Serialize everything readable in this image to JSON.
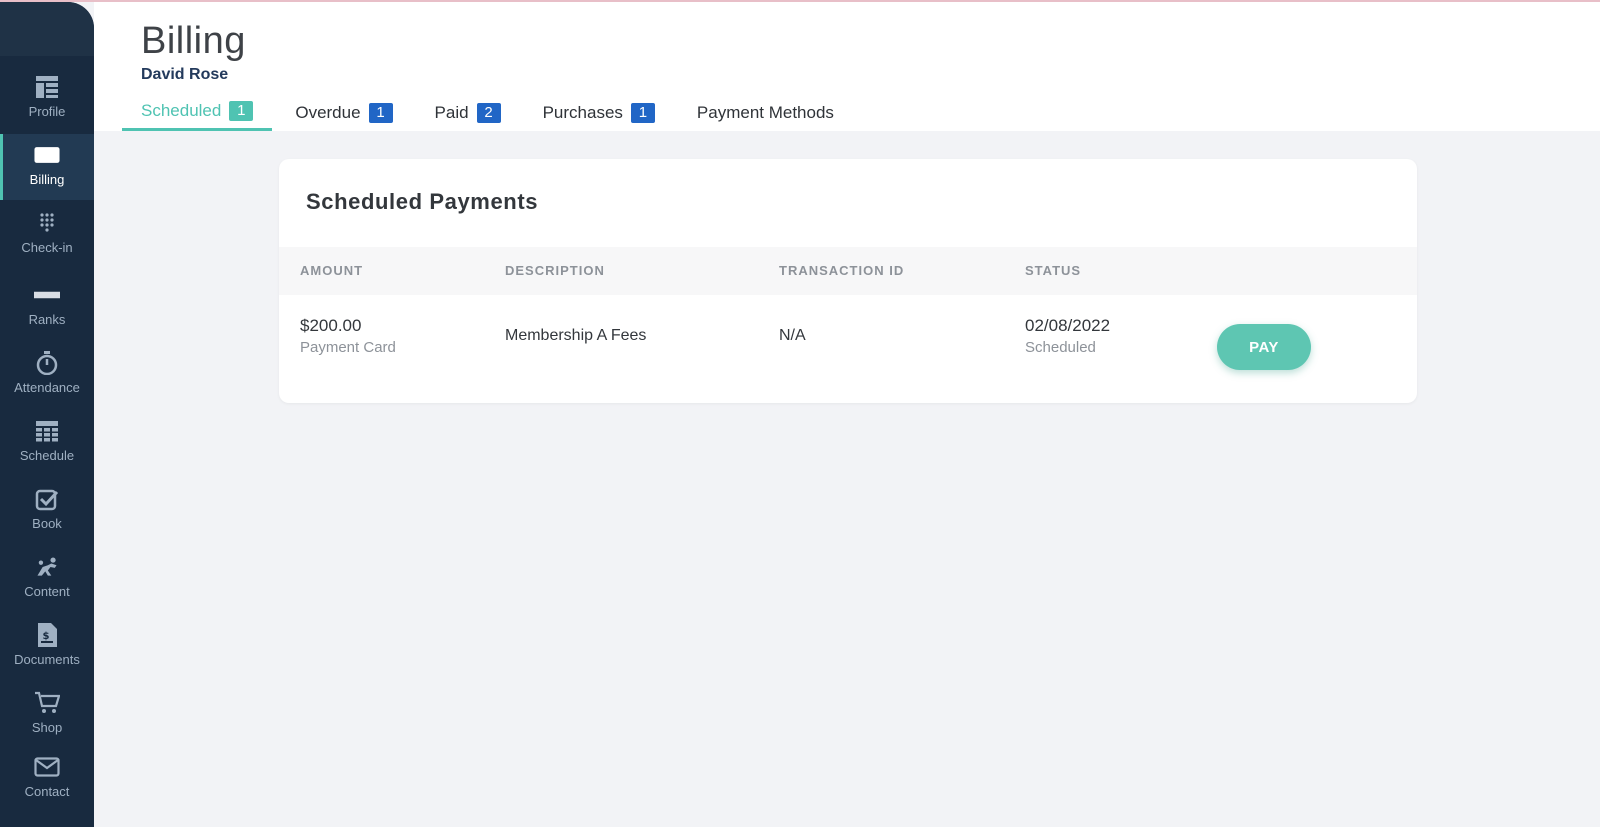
{
  "page": {
    "title": "Billing",
    "user_name": "David Rose"
  },
  "sidebar": {
    "items": [
      {
        "label": "Profile",
        "icon": "profile-icon",
        "active": false
      },
      {
        "label": "Billing",
        "icon": "billing-icon",
        "active": true
      },
      {
        "label": "Check-in",
        "icon": "keypad-icon",
        "active": false
      },
      {
        "label": "Ranks",
        "icon": "rank-belt-icon",
        "active": false
      },
      {
        "label": "Attendance",
        "icon": "stopwatch-icon",
        "active": false
      },
      {
        "label": "Schedule",
        "icon": "calendar-grid-icon",
        "active": false
      },
      {
        "label": "Book",
        "icon": "checkbox-icon",
        "active": false
      },
      {
        "label": "Content",
        "icon": "martial-arts-icon",
        "active": false
      },
      {
        "label": "Documents",
        "icon": "document-icon",
        "active": false
      },
      {
        "label": "Shop",
        "icon": "cart-icon",
        "active": false
      },
      {
        "label": "Contact",
        "icon": "envelope-icon",
        "active": false
      }
    ]
  },
  "tabs": [
    {
      "label": "Scheduled",
      "count": "1",
      "active": true
    },
    {
      "label": "Overdue",
      "count": "1",
      "active": false
    },
    {
      "label": "Paid",
      "count": "2",
      "active": false
    },
    {
      "label": "Purchases",
      "count": "1",
      "active": false
    },
    {
      "label": "Payment Methods",
      "count": null,
      "active": false
    }
  ],
  "scheduled_payments": {
    "title": "Scheduled Payments",
    "columns": [
      "AMOUNT",
      "DESCRIPTION",
      "TRANSACTION ID",
      "STATUS"
    ],
    "rows": [
      {
        "amount": "$200.00",
        "method": "Payment Card",
        "description": "Membership A Fees",
        "transaction_id": "N/A",
        "date": "02/08/2022",
        "status": "Scheduled",
        "action_label": "PAY"
      }
    ]
  },
  "colors": {
    "accent": "#4fc3b2",
    "sidebar_bg": "#182a3f",
    "badge_blue": "#2166c6",
    "pay_button": "#5ec6b2"
  }
}
